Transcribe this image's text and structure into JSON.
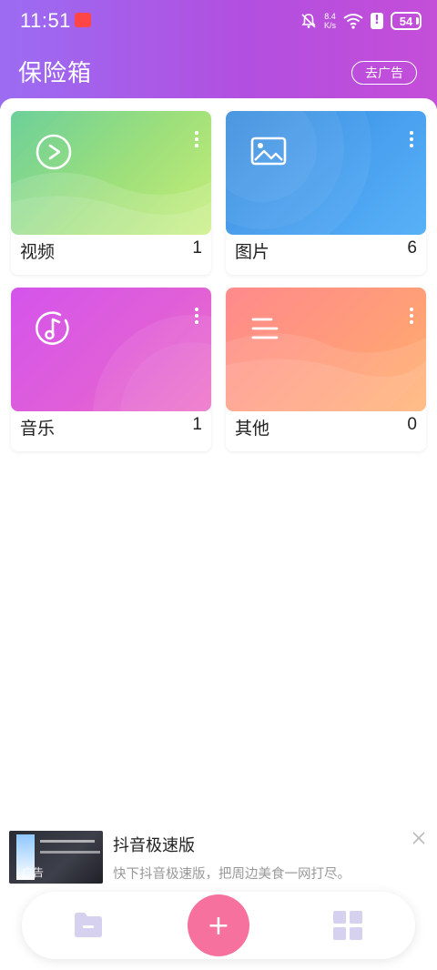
{
  "status_bar": {
    "time": "11:51",
    "speed_value": "8.4",
    "speed_unit": "K/s",
    "battery": "54"
  },
  "header": {
    "title": "保险箱",
    "ad_button": "去广告"
  },
  "categories": [
    {
      "label": "视频",
      "count": "1",
      "icon": "play-icon"
    },
    {
      "label": "图片",
      "count": "6",
      "icon": "image-icon"
    },
    {
      "label": "音乐",
      "count": "1",
      "icon": "music-icon"
    },
    {
      "label": "其他",
      "count": "0",
      "icon": "list-icon"
    }
  ],
  "ad": {
    "tag": "广告",
    "title": "抖音极速版",
    "description": "快下抖音极速版，把周边美食一网打尽。"
  },
  "bottom_nav": {
    "add_label": "+"
  },
  "colors": {
    "header_start": "#9b6cf2",
    "header_end": "#c44ed8",
    "video_card": "#7fd487",
    "image_card": "#3b8ee6",
    "music_card": "#d159e8",
    "other_card": "#ff8c86",
    "add_button": "#f7719e"
  }
}
